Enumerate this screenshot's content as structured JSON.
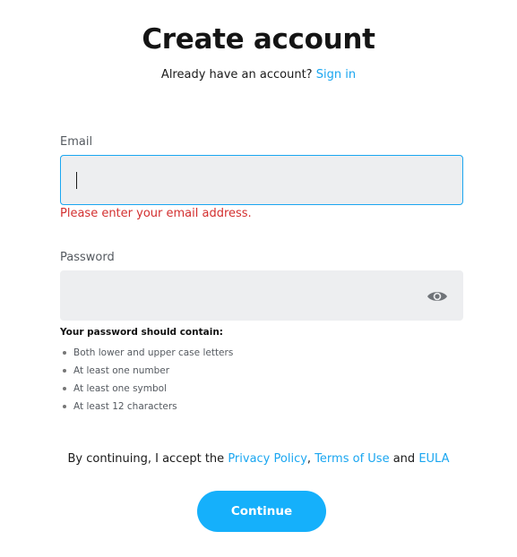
{
  "header": {
    "title": "Create account",
    "signin_prompt": "Already have an account?",
    "signin_link": "Sign in"
  },
  "email": {
    "label": "Email",
    "value": "",
    "error": "Please enter your email address."
  },
  "password": {
    "label": "Password",
    "value": "",
    "toggle_icon": "eye-icon"
  },
  "requirements": {
    "title": "Your password should contain:",
    "items": [
      "Both lower and upper case letters",
      "At least one number",
      "At least one symbol",
      "At least 12 characters"
    ]
  },
  "terms": {
    "prefix": "By continuing, I accept the",
    "privacy": "Privacy Policy",
    "separator": ",",
    "terms_of_use": "Terms of Use",
    "and": "and",
    "eula": "EULA"
  },
  "actions": {
    "continue_label": "Continue"
  },
  "colors": {
    "accent": "#15b0fb",
    "link": "#1aa6f0",
    "error": "#d32f2f",
    "field_bg": "#edeef0"
  }
}
